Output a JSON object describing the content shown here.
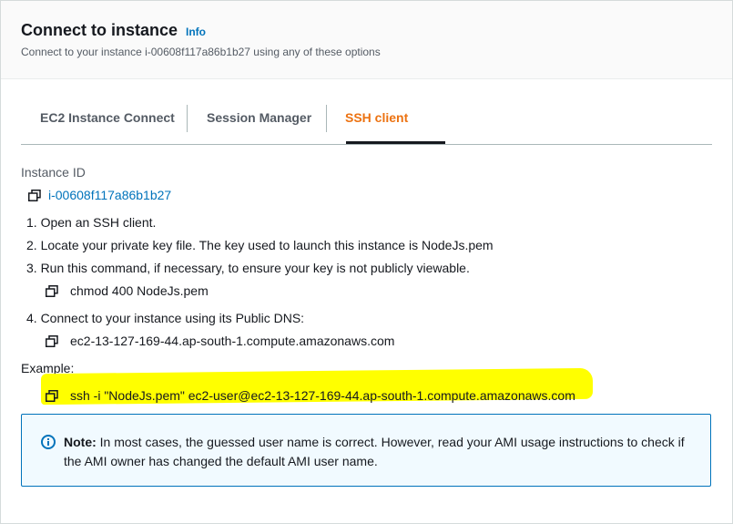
{
  "header": {
    "title": "Connect to instance",
    "info_link": "Info",
    "description": "Connect to your instance i-00608f117a86b1b27 using any of these options"
  },
  "tabs": [
    {
      "label": "EC2 Instance Connect",
      "active": false
    },
    {
      "label": "Session Manager",
      "active": false
    },
    {
      "label": "SSH client",
      "active": true
    }
  ],
  "instance": {
    "label": "Instance ID",
    "id": "i-00608f117a86b1b27"
  },
  "steps": {
    "step1": "1. Open an SSH client.",
    "step2": "2. Locate your private key file. The key used to launch this instance is NodeJs.pem",
    "step3": "3. Run this command, if necessary, to ensure your key is not publicly viewable.",
    "step3_command": "chmod 400 NodeJs.pem",
    "step4": "4. Connect to your instance using its Public DNS:",
    "step4_dns": "ec2-13-127-169-44.ap-south-1.compute.amazonaws.com"
  },
  "example": {
    "label": "Example:",
    "command": "ssh -i \"NodeJs.pem\" ec2-user@ec2-13-127-169-44.ap-south-1.compute.amazonaws.com",
    "highlight_color": "#ffff00"
  },
  "note": {
    "prefix": "Note:",
    "text": " In most cases, the guessed user name is correct. However, read your AMI usage instructions to check if the AMI owner has changed the default AMI user name."
  },
  "colors": {
    "accent": "#ec7211",
    "link": "#0073bb",
    "info_border": "#0073bb",
    "info_bg": "#f1faff"
  }
}
